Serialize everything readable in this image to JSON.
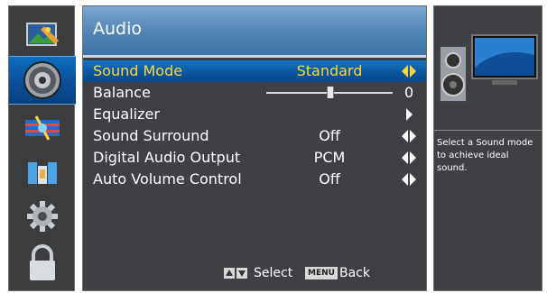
{
  "categories": [
    {
      "icon": "picture-icon"
    },
    {
      "icon": "audio-speaker-icon"
    },
    {
      "icon": "channel-globe-icon"
    },
    {
      "icon": "lock-parental-icon"
    },
    {
      "icon": "settings-gear-icon"
    },
    {
      "icon": "padlock-icon"
    }
  ],
  "menu": {
    "title": "Audio",
    "items": [
      {
        "label": "Sound Mode",
        "value": "Standard",
        "control": "left-right"
      },
      {
        "label": "Balance",
        "value": "0",
        "control": "slider",
        "level": 0.5
      },
      {
        "label": "Equalizer",
        "value": "",
        "control": "right"
      },
      {
        "label": "Sound Surround",
        "value": "Off",
        "control": "left-right"
      },
      {
        "label": "Digital Audio Output",
        "value": "PCM",
        "control": "left-right"
      },
      {
        "label": "Auto Volume Control",
        "value": "Off",
        "control": "left-right"
      }
    ]
  },
  "footer": {
    "select_label": "Select",
    "menu_key": "MENU",
    "back_label": "Back"
  },
  "info": {
    "description": "Select a Sound mode to achieve ideal sound."
  },
  "colors": {
    "selected_text": "#ffd53a",
    "selection_blue": "#0b579f",
    "panel_bg": "#3e4043"
  }
}
